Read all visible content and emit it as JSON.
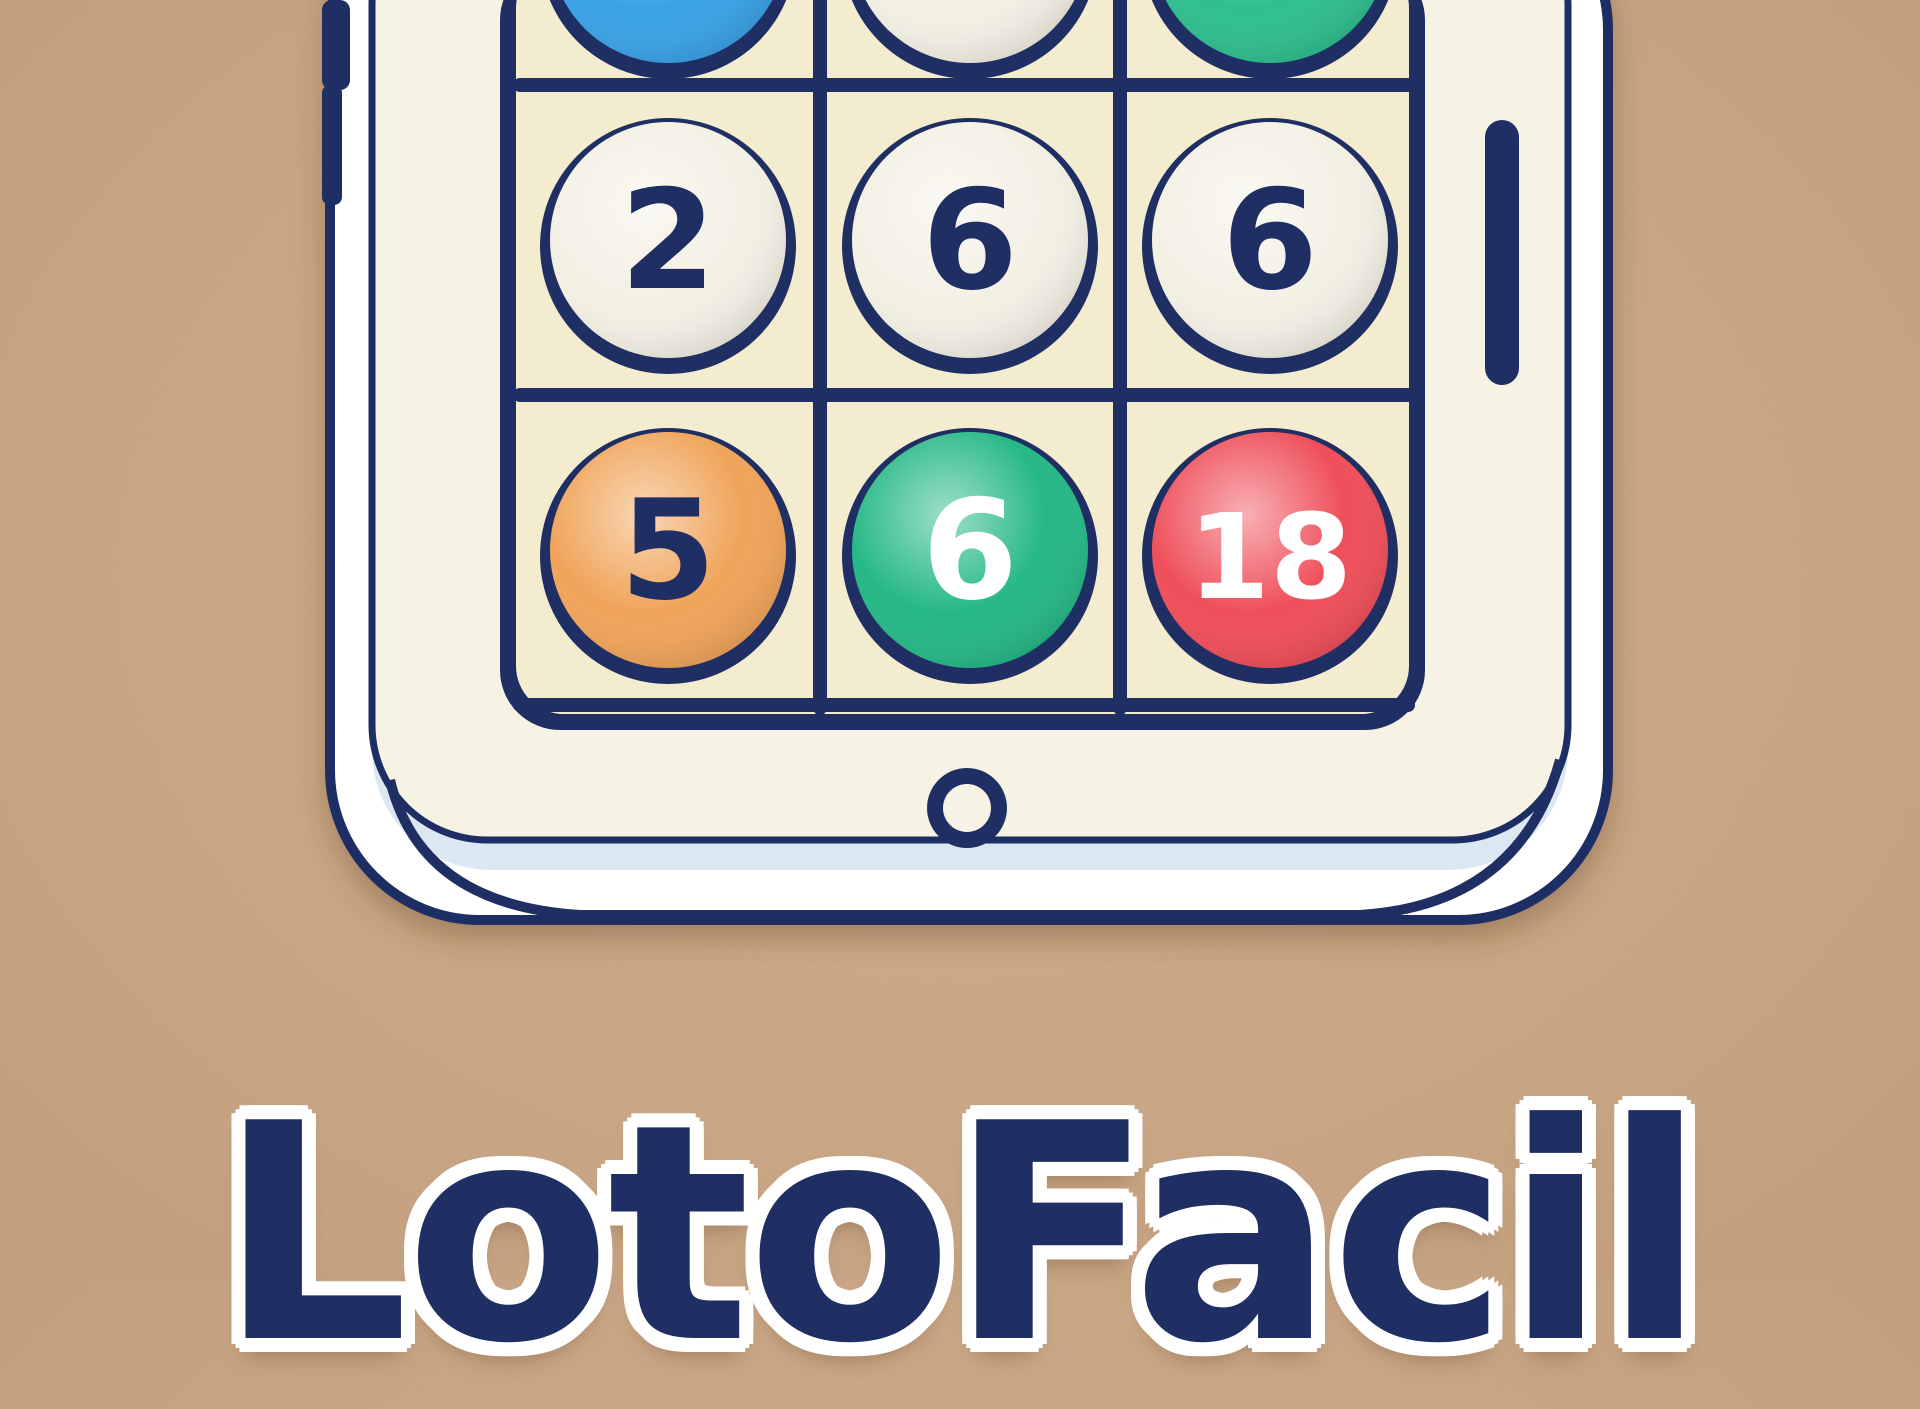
{
  "brand": {
    "wordmark": "LotoFacil",
    "color_navy": "#1f2f63",
    "color_ivory": "#f6f2e4"
  },
  "grid": {
    "rows": [
      [
        {
          "label": "",
          "color": "#3aa3e6"
        },
        {
          "label": "",
          "color": "#f3f0e4"
        },
        {
          "label": "",
          "color": "#2fbf8f"
        }
      ],
      [
        {
          "label": "2",
          "color": "#f3f0e4"
        },
        {
          "label": "6",
          "color": "#f3f0e4"
        },
        {
          "label": "6",
          "color": "#f3f0e4"
        }
      ],
      [
        {
          "label": "5",
          "color": "#f0a45a"
        },
        {
          "label": "6",
          "color": "#26b887"
        },
        {
          "label": "18",
          "color": "#ef4f5a"
        }
      ]
    ]
  },
  "device": {
    "home_button_icon": "home-button-icon",
    "side_button_icon": "side-button-icon"
  }
}
